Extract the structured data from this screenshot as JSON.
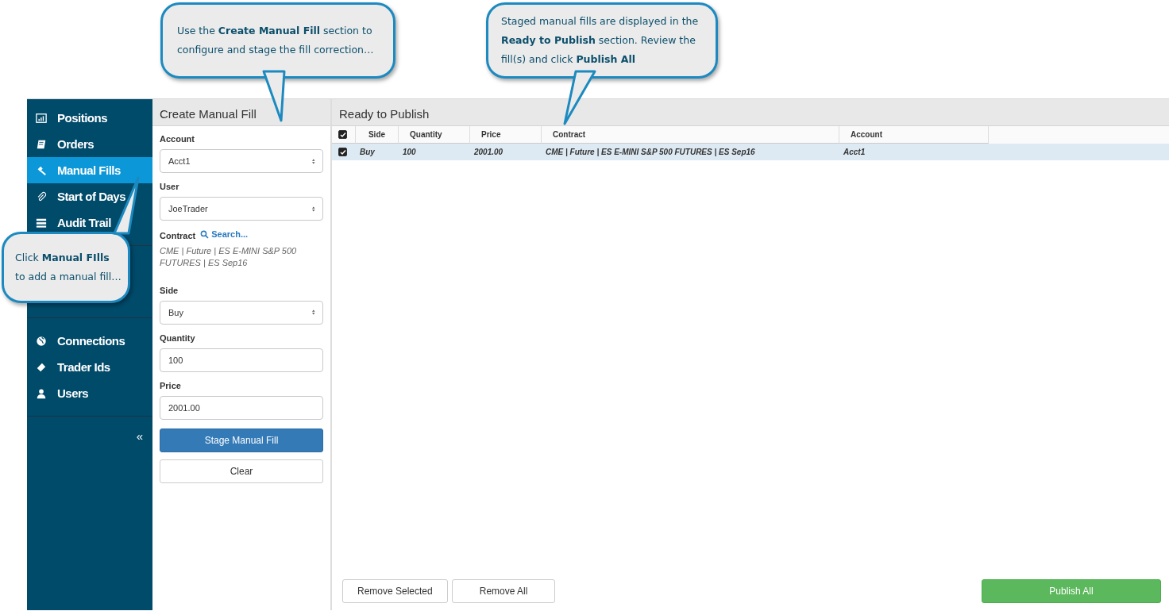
{
  "callouts": [
    {
      "text": "Use the **Create Manual Fill** section to configure and stage the fill correction…"
    },
    {
      "text": "Staged manual fills are displayed in the **Ready to Publish** section. Review the fill(s) and click **Publish All**"
    },
    {
      "text": "Click **Manual FIlls** to add a manual fill…"
    }
  ],
  "sidebar": {
    "main_items": [
      {
        "label": "Positions",
        "selected": false
      },
      {
        "label": "Orders",
        "selected": false
      },
      {
        "label": "Manual Fills",
        "selected": true
      },
      {
        "label": "Start of Days",
        "selected": false
      },
      {
        "label": "Audit Trail",
        "selected": false
      }
    ],
    "admin_items": [
      {
        "label": "Connections",
        "selected": false
      },
      {
        "label": "Trader Ids",
        "selected": false
      },
      {
        "label": "Users",
        "selected": false
      }
    ],
    "collapse": "«"
  },
  "create_panel": {
    "title": "Create Manual Fill",
    "fields": [
      {
        "kind": "select",
        "label": "Account",
        "value": "Acct1"
      },
      {
        "kind": "select",
        "label": "User",
        "value": "JoeTrader"
      },
      {
        "kind": "contract",
        "label": "Contract",
        "link": "Search...",
        "value": "CME | Future | ES E-MINI S&P 500 FUTURES | ES Sep16"
      },
      {
        "kind": "select",
        "label": "Side",
        "value": "Buy"
      },
      {
        "kind": "input",
        "label": "Quantity",
        "value": "100"
      },
      {
        "kind": "input",
        "label": "Price",
        "value": "2001.00"
      }
    ],
    "buttons": [
      {
        "label": "Stage Manual Fill",
        "kind": "primary"
      },
      {
        "label": "Clear",
        "kind": "default"
      }
    ]
  },
  "publish_panel": {
    "title": "Ready to Publish",
    "table": {
      "header_checked": true,
      "columns": [
        "Side",
        "Quantity",
        "Price",
        "Contract",
        "Account"
      ],
      "rows": [
        {
          "checked": true,
          "selected": true,
          "cells": [
            "Buy",
            "100",
            "2001.00",
            "CME | Future | ES E-MINI S&P 500 FUTURES | ES Sep16",
            "Acct1"
          ]
        }
      ]
    },
    "buttons": [
      {
        "label": "Remove Selected",
        "kind": "default"
      },
      {
        "label": "Remove All",
        "kind": "default"
      },
      {
        "label": "Publish All",
        "kind": "success"
      }
    ]
  }
}
